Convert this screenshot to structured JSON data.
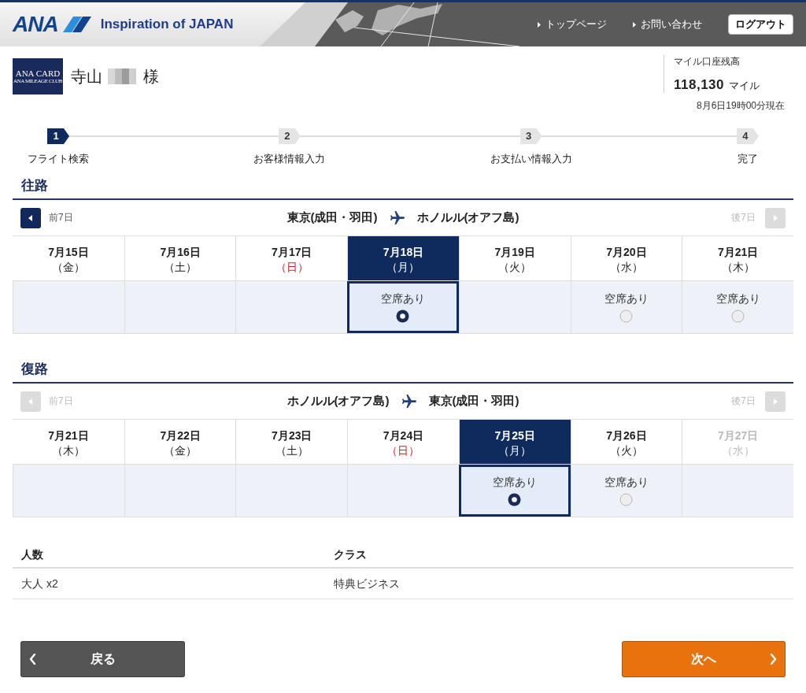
{
  "header": {
    "logo_text": "ANA",
    "tagline": "Inspiration of JAPAN",
    "nav_links": [
      "トップページ",
      "お問い合わせ"
    ],
    "logout_button": "ログアウト"
  },
  "member": {
    "card_title": "ANA CARD",
    "card_subtitle": "ANA MILEAGE CLUB",
    "surname": "寺山",
    "honorific": "様",
    "balance_label": "マイル口座残高",
    "balance": "118,130",
    "balance_unit": "マイル",
    "balance_as_of": "8月6日19時00分現在"
  },
  "steps": [
    {
      "number": "1",
      "label": "フライト検索",
      "selected": true
    },
    {
      "number": "2",
      "label": "お客様情報入力",
      "selected": false
    },
    {
      "number": "3",
      "label": "お支払い情報入力",
      "selected": false
    },
    {
      "number": "4",
      "label": "完了",
      "selected": false
    }
  ],
  "legs": [
    {
      "title": "往路",
      "prev": {
        "label": "前7日",
        "disabled": false
      },
      "next": {
        "label": "後7日",
        "disabled": true
      },
      "from": "東京(成田・羽田)",
      "to": "ホノルル(オアフ島)",
      "dates": [
        {
          "date": "7月15日",
          "weekday": "（金）",
          "sunday": false,
          "disabled": false,
          "selected": false
        },
        {
          "date": "7月16日",
          "weekday": "（土）",
          "sunday": false,
          "disabled": false,
          "selected": false
        },
        {
          "date": "7月17日",
          "weekday": "（日）",
          "sunday": true,
          "disabled": false,
          "selected": false
        },
        {
          "date": "7月18日",
          "weekday": "（月）",
          "sunday": false,
          "disabled": false,
          "selected": true,
          "availability": "空席あり"
        },
        {
          "date": "7月19日",
          "weekday": "（火）",
          "sunday": false,
          "disabled": false,
          "selected": false
        },
        {
          "date": "7月20日",
          "weekday": "（水）",
          "sunday": false,
          "disabled": false,
          "selected": false,
          "availability": "空席あり"
        },
        {
          "date": "7月21日",
          "weekday": "（木）",
          "sunday": false,
          "disabled": false,
          "selected": false,
          "availability": "空席あり"
        }
      ]
    },
    {
      "title": "復路",
      "prev": {
        "label": "前7日",
        "disabled": true
      },
      "next": {
        "label": "後7日",
        "disabled": true
      },
      "from": "ホノルル(オアフ島)",
      "to": "東京(成田・羽田)",
      "dates": [
        {
          "date": "7月21日",
          "weekday": "（木）",
          "sunday": false,
          "disabled": false,
          "selected": false
        },
        {
          "date": "7月22日",
          "weekday": "（金）",
          "sunday": false,
          "disabled": false,
          "selected": false
        },
        {
          "date": "7月23日",
          "weekday": "（土）",
          "sunday": false,
          "disabled": false,
          "selected": false
        },
        {
          "date": "7月24日",
          "weekday": "（日）",
          "sunday": true,
          "disabled": false,
          "selected": false
        },
        {
          "date": "7月25日",
          "weekday": "（月）",
          "sunday": false,
          "disabled": false,
          "selected": true,
          "availability": "空席あり"
        },
        {
          "date": "7月26日",
          "weekday": "（火）",
          "sunday": false,
          "disabled": false,
          "selected": false,
          "availability": "空席あり"
        },
        {
          "date": "7月27日",
          "weekday": "（水）",
          "sunday": false,
          "disabled": true,
          "selected": false
        }
      ]
    }
  ],
  "summary": {
    "columns": [
      "人数",
      "クラス"
    ],
    "rows": [
      [
        "大人 x2",
        "特典ビジネス"
      ]
    ]
  },
  "buttons": [
    {
      "kind": "back",
      "label": "戻る"
    },
    {
      "kind": "next",
      "label": "次へ"
    }
  ]
}
